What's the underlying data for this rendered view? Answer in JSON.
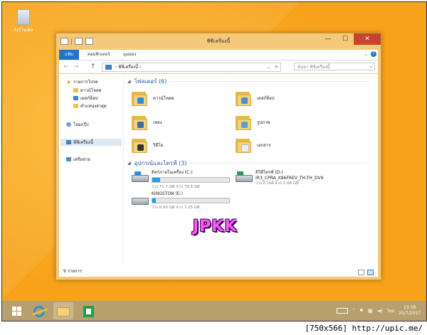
{
  "desktop": {
    "recycle_bin_label": "ถังรีไซเคิล"
  },
  "window": {
    "title": "พีซีเครื่องนี้",
    "controls": {
      "minimize": "—",
      "maximize": "☐",
      "close": "✕"
    },
    "ribbon": {
      "tabs": [
        "แฟ้ม",
        "คอมพิวเตอร์",
        "มุมมอง"
      ],
      "collapse_symbol": "⌄",
      "help_symbol": "?"
    },
    "address": {
      "back": "←",
      "forward": "→",
      "up": "↑",
      "path": "พีซีเครื่องนี้",
      "path_sep": "›",
      "dropdown": "⌄",
      "refresh": "↻",
      "search_placeholder": "ค้นหา พีซีเครื่องนี้"
    },
    "nav_pane": {
      "favorites": "รายการโปรด",
      "favorites_children": [
        "ดาวน์โหลด",
        "เดสก์ท็อป",
        "ตำแหน่งล่าสุด"
      ],
      "onedrive": "โฮมกรุ๊ป",
      "this_pc": "พีซีเครื่องนี้",
      "network": "เครือข่าย"
    },
    "folders_group": {
      "title": "โฟลเดอร์ (6)",
      "items": [
        "ดาวน์โหลด",
        "เดสก์ท็อป",
        "เพลง",
        "รูปภาพ",
        "วิดีโอ",
        "เอกสาร"
      ]
    },
    "devices_group": {
      "title": "อุปกรณ์และไดรฟ์ (3)",
      "drives": [
        {
          "name": "ดิสก์ภายในเครื่อง (C:)",
          "free_text": "ว่าง 71.7 GB จาก 79.6 GB",
          "used_fraction": 0.1
        },
        {
          "name": "ดีวีดีไดรฟ์ (D:)",
          "label2": "IR3_CPRA_X86FREV_TH-TH_DV9",
          "free_text": "ว่าง 0 ไบต์ จาก 2.68 GB",
          "used_fraction": 1.0
        },
        {
          "name": "KINGSTON (E:)",
          "free_text": "ว่าง 6.93 GB จาก 7.25 GB",
          "used_fraction": 0.05
        }
      ]
    },
    "status": {
      "item_count": "9 รายการ"
    }
  },
  "watermark_text": "JPKK",
  "taskbar": {
    "tray_language": "ไทย",
    "time": "13:58",
    "date": "25/7/2557"
  },
  "image_footer": "[750x566] http://upic.me/",
  "colors": {
    "desktop": "#f7a21a",
    "window_frame": "#f5c97a",
    "accent": "#1f76c7",
    "close": "#c7432f",
    "taskbar": "#b5a071"
  }
}
